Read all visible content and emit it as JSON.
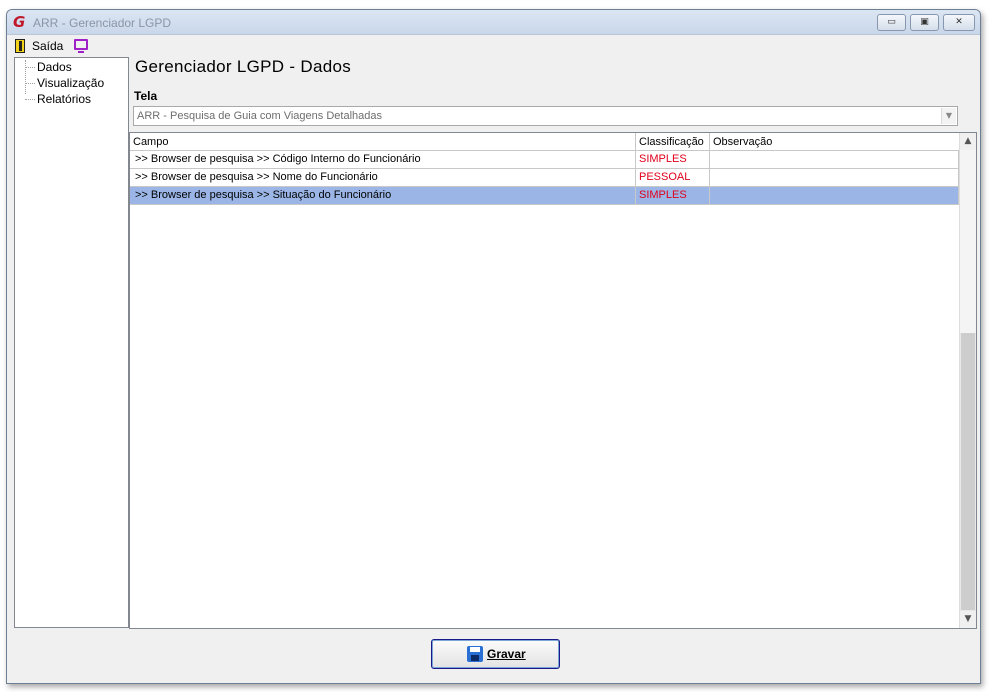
{
  "window": {
    "title": "ARR - Gerenciador LGPD",
    "logo_letter": "G",
    "minimize_glyph": "▭",
    "maximize_glyph": "▣",
    "close_glyph": "✕"
  },
  "menu": {
    "exit_label": "Saída",
    "exit_icon": "exit-door-icon",
    "screen_icon": "monitor-icon"
  },
  "tree": {
    "items": [
      {
        "label": "Dados"
      },
      {
        "label": "Visualização"
      },
      {
        "label": "Relatórios"
      }
    ]
  },
  "main": {
    "title": "Gerenciador LGPD - Dados",
    "tela_label": "Tela",
    "tela_value": "ARR - Pesquisa de Guia com Viagens Detalhadas"
  },
  "grid": {
    "columns": [
      "Campo",
      "Classificação",
      "Observação"
    ],
    "rows": [
      {
        "campo": ">> Browser de pesquisa >> Código Interno do Funcionário",
        "classificacao": "SIMPLES",
        "observacao": ""
      },
      {
        "campo": ">> Browser de pesquisa >> Nome do Funcionário",
        "classificacao": "PESSOAL",
        "observacao": ""
      },
      {
        "campo": ">> Browser de pesquisa >> Situação do Funcionário",
        "classificacao": "SIMPLES",
        "observacao": "",
        "selected": true
      }
    ]
  },
  "footer": {
    "save_label": "Gravar",
    "save_icon": "floppy-disk-icon"
  },
  "colors": {
    "classification_text": "#e0001a",
    "selected_row": "#9bb6e6"
  }
}
